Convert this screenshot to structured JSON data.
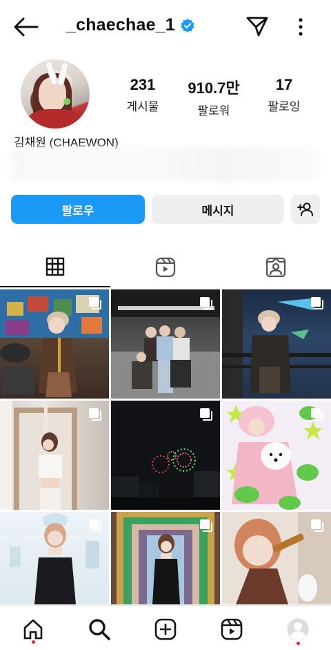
{
  "header": {
    "username": "_chaechae_1",
    "verified": true,
    "icons": [
      "back-arrow-icon",
      "verified-badge-icon",
      "send-icon",
      "more-icon"
    ]
  },
  "profile": {
    "display_name": "김채원 (CHAEWON)",
    "stats": {
      "posts": {
        "value": "231",
        "label": "게시물"
      },
      "followers": {
        "value": "910.7만",
        "label": "팔로워"
      },
      "following": {
        "value": "17",
        "label": "팔로잉"
      }
    }
  },
  "actions": {
    "follow_label": "팔로우",
    "message_label": "메시지",
    "suggest_icon": "add-person-icon"
  },
  "tabs": [
    {
      "name": "grid",
      "icon": "grid-icon",
      "active": true
    },
    {
      "name": "reels",
      "icon": "reels-icon",
      "active": false
    },
    {
      "name": "tagged",
      "icon": "tagged-icon",
      "active": false
    }
  ],
  "posts": [
    {
      "id": 1,
      "multi": true
    },
    {
      "id": 2,
      "multi": true
    },
    {
      "id": 3,
      "multi": true
    },
    {
      "id": 4,
      "multi": true
    },
    {
      "id": 5,
      "multi": true
    },
    {
      "id": 6,
      "multi": true
    },
    {
      "id": 7,
      "multi": true
    },
    {
      "id": 8,
      "multi": true
    },
    {
      "id": 9,
      "multi": true
    }
  ],
  "bottom_nav": [
    {
      "name": "home",
      "icon": "home-icon",
      "notification_dot": true
    },
    {
      "name": "search",
      "icon": "search-icon",
      "notification_dot": false
    },
    {
      "name": "create",
      "icon": "create-icon",
      "notification_dot": false
    },
    {
      "name": "reels",
      "icon": "reels-icon",
      "notification_dot": false
    },
    {
      "name": "profile",
      "icon": "profile-icon",
      "notification_dot": true
    }
  ],
  "colors": {
    "follow_button": "#1a9af5",
    "secondary_button": "#efefef",
    "verified": "#1a9af5",
    "notification": "#e8232f"
  }
}
